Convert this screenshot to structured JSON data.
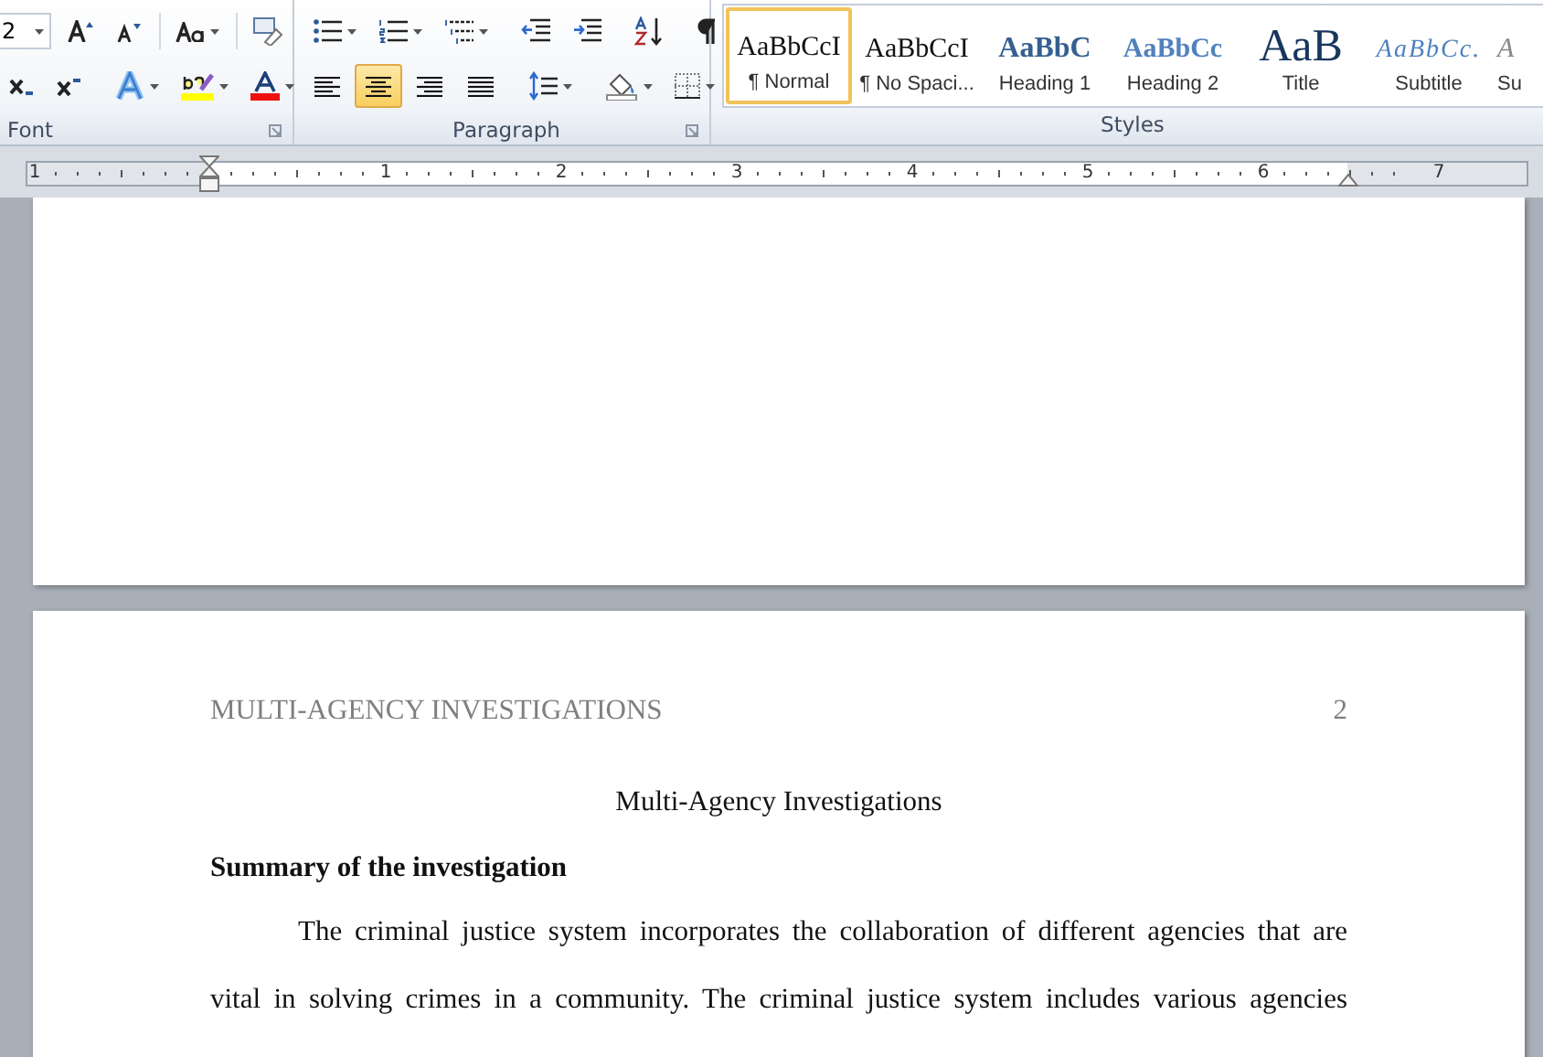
{
  "ribbon": {
    "font_group": {
      "font_size": "2",
      "label": "Font"
    },
    "paragraph_group": {
      "label": "Paragraph",
      "alignments": [
        {
          "kind": "left",
          "selected": false
        },
        {
          "kind": "center",
          "selected": true
        },
        {
          "kind": "right",
          "selected": false
        },
        {
          "kind": "justify",
          "selected": false
        }
      ]
    },
    "styles_group": {
      "label": "Styles",
      "styles": [
        {
          "kind": "normal",
          "sample": "AaBbCcI",
          "name": "¶ Normal",
          "selected": true
        },
        {
          "kind": "normal",
          "sample": "AaBbCcI",
          "name": "¶ No Spaci...",
          "selected": false
        },
        {
          "kind": "heading1",
          "sample": "AaBbC",
          "name": "Heading 1",
          "selected": false
        },
        {
          "kind": "heading2",
          "sample": "AaBbCc",
          "name": "Heading 2",
          "selected": false
        },
        {
          "kind": "title",
          "sample": "AaB",
          "name": "Title",
          "selected": false
        },
        {
          "kind": "subtitle",
          "sample": "AaBbCc.",
          "name": "Subtitle",
          "selected": false
        },
        {
          "kind": "emphasis",
          "sample": "A",
          "name": "Su",
          "selected": false
        }
      ]
    }
  },
  "ruler": {
    "numbers": [
      "1",
      "1",
      "2",
      "3",
      "4",
      "5",
      "6",
      "7"
    ]
  },
  "document": {
    "header": "MULTI-AGENCY INVESTIGATIONS",
    "page_number": "2",
    "title": "Multi-Agency Investigations",
    "heading": "Summary of the investigation",
    "body_lines": [
      "The criminal justice system incorporates the collaboration of different agencies that are",
      "vital in solving crimes in a community. The criminal justice system includes various agencies"
    ]
  }
}
